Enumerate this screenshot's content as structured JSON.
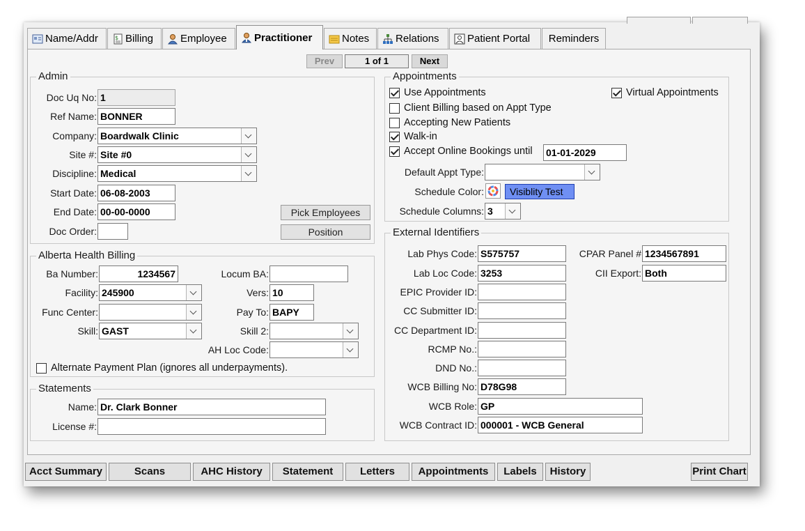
{
  "tabs": [
    {
      "label": "Name/Addr",
      "icon": "id-card-icon"
    },
    {
      "label": "Billing",
      "icon": "invoice-icon"
    },
    {
      "label": "Employee",
      "icon": "person-icon"
    },
    {
      "label": "Practitioner",
      "icon": "doctor-icon",
      "active": true
    },
    {
      "label": "Notes",
      "icon": "note-icon"
    },
    {
      "label": "Relations",
      "icon": "org-chart-icon"
    },
    {
      "label": "Patient Portal",
      "icon": "portal-icon"
    },
    {
      "label": "Reminders",
      "icon": ""
    }
  ],
  "nav": {
    "prev": "Prev",
    "counter": "1 of 1",
    "next": "Next"
  },
  "admin": {
    "title": "Admin",
    "doc_uq_no": {
      "label": "Doc Uq No:",
      "value": "1"
    },
    "ref_name": {
      "label": "Ref Name:",
      "value": "BONNER"
    },
    "company": {
      "label": "Company:",
      "value": "Boardwalk Clinic"
    },
    "site": {
      "label": "Site #:",
      "value": "Site #0"
    },
    "discipline": {
      "label": "Discipline:",
      "value": "Medical"
    },
    "start_date": {
      "label": "Start Date:",
      "value": "06-08-2003"
    },
    "end_date": {
      "label": "End Date:",
      "value": "00-00-0000"
    },
    "doc_order": {
      "label": "Doc Order:",
      "value": ""
    },
    "pick_employees": "Pick Employees",
    "position": "Position"
  },
  "ahb": {
    "title": "Alberta Health Billing",
    "ba_number": {
      "label": "Ba Number:",
      "value": "1234567"
    },
    "locum_ba": {
      "label": "Locum BA:",
      "value": ""
    },
    "facility": {
      "label": "Facility:",
      "value": "245900"
    },
    "vers": {
      "label": "Vers:",
      "value": "10"
    },
    "func_center": {
      "label": "Func Center:",
      "value": ""
    },
    "pay_to": {
      "label": "Pay To:",
      "value": "BAPY"
    },
    "skill": {
      "label": "Skill:",
      "value": "GAST"
    },
    "skill2": {
      "label": "Skill 2:",
      "value": ""
    },
    "ah_loc_code": {
      "label": "AH Loc Code:",
      "value": ""
    },
    "alt_payment": {
      "label": "Alternate Payment Plan (ignores all underpayments).",
      "checked": false
    }
  },
  "statements": {
    "title": "Statements",
    "name": {
      "label": "Name:",
      "value": "Dr. Clark Bonner"
    },
    "license": {
      "label": "License #:",
      "value": ""
    }
  },
  "appointments": {
    "title": "Appointments",
    "use_appointments": {
      "label": "Use Appointments",
      "checked": true
    },
    "virtual_appointments": {
      "label": "Virtual Appointments",
      "checked": true
    },
    "client_billing": {
      "label": "Client Billing based on Appt Type",
      "checked": false
    },
    "accepting_new": {
      "label": "Accepting New Patients",
      "checked": false
    },
    "walk_in": {
      "label": "Walk-in",
      "checked": true
    },
    "online_bookings": {
      "label": "Accept Online Bookings until",
      "checked": true,
      "value": "01-01-2029"
    },
    "default_appt_type": {
      "label": "Default Appt Type:",
      "value": ""
    },
    "schedule_color": {
      "label": "Schedule Color:",
      "swatch_text": "Visiblity Test",
      "color": "#6f8ff3"
    },
    "schedule_columns": {
      "label": "Schedule Columns:",
      "value": "3"
    }
  },
  "external": {
    "title": "External Identifiers",
    "lab_phys_code": {
      "label": "Lab Phys Code:",
      "value": "S575757"
    },
    "cpar_panel": {
      "label": "CPAR Panel #",
      "value": "1234567891"
    },
    "lab_loc_code": {
      "label": "Lab Loc Code:",
      "value": "3253"
    },
    "cii_export": {
      "label": "CII Export:",
      "value": "Both"
    },
    "epic_provider": {
      "label": "EPIC Provider ID:",
      "value": ""
    },
    "cc_submitter": {
      "label": "CC Submitter ID:",
      "value": ""
    },
    "cc_department": {
      "label": "CC Department ID:",
      "value": ""
    },
    "rcmp_no": {
      "label": "RCMP No.:",
      "value": ""
    },
    "dnd_no": {
      "label": "DND No.:",
      "value": ""
    },
    "wcb_billing": {
      "label": "WCB Billing No:",
      "value": "D78G98"
    },
    "wcb_role": {
      "label": "WCB Role:",
      "value": "GP"
    },
    "wcb_contract": {
      "label": "WCB Contract ID:",
      "value": "000001 - WCB General"
    }
  },
  "bottom_buttons": [
    "Acct Summary",
    "Scans",
    "AHC History",
    "Statement",
    "Letters",
    "Appointments",
    "Labels",
    "History",
    "Print Chart"
  ]
}
